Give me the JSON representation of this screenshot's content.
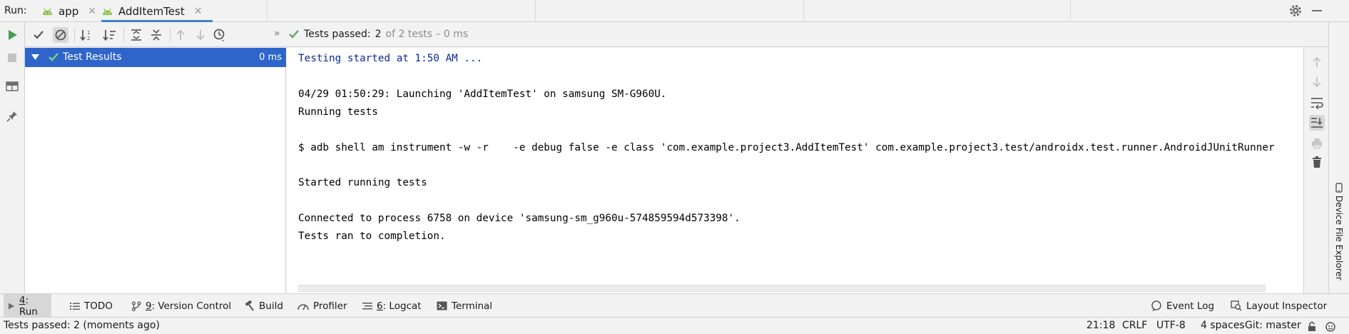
{
  "run_tabs": {
    "label": "Run:",
    "tabs": [
      {
        "label": "app"
      },
      {
        "label": "AddItemTest"
      }
    ]
  },
  "toolbar": {
    "status_prefix": "Tests passed:",
    "status_count": "2",
    "status_suffix": "of 2 tests – 0 ms"
  },
  "tree": {
    "root_label": "Test Results",
    "root_time": "0 ms"
  },
  "console": {
    "lines": [
      "Testing started at 1:50 AM ...",
      "",
      "04/29 01:50:29: Launching 'AddItemTest' on samsung SM-G960U.",
      "Running tests",
      "",
      "$ adb shell am instrument -w -r    -e debug false -e class 'com.example.project3.AddItemTest' com.example.project3.test/androidx.test.runner.AndroidJUnitRunner",
      "",
      "Started running tests",
      "",
      "Connected to process 6758 on device 'samsung-sm_g960u-574859594d573398'.",
      "Tests ran to completion."
    ]
  },
  "side_strip": {
    "label": "Device File Explorer"
  },
  "tool_windows": {
    "run": {
      "num": "4",
      "label": ": Run"
    },
    "todo": {
      "label": "TODO"
    },
    "vcs": {
      "num": "9",
      "label": ": Version Control"
    },
    "build": {
      "label": "Build"
    },
    "profiler": {
      "label": "Profiler"
    },
    "logcat": {
      "num": "6",
      "label": ": Logcat"
    },
    "terminal": {
      "label": "Terminal"
    },
    "event_log": {
      "label": "Event Log"
    },
    "layout_inspector": {
      "label": "Layout Inspector"
    }
  },
  "status_bar": {
    "message": "Tests passed: 2 (moments ago)",
    "position": "21:18",
    "line_sep": "CRLF",
    "encoding": "UTF-8",
    "indent": "4 spaces",
    "vcs": "Git: master"
  },
  "colors": {
    "accent": "#4083c9",
    "selection": "#2f65ca",
    "success": "#59a869",
    "run_green": "#499c54"
  }
}
